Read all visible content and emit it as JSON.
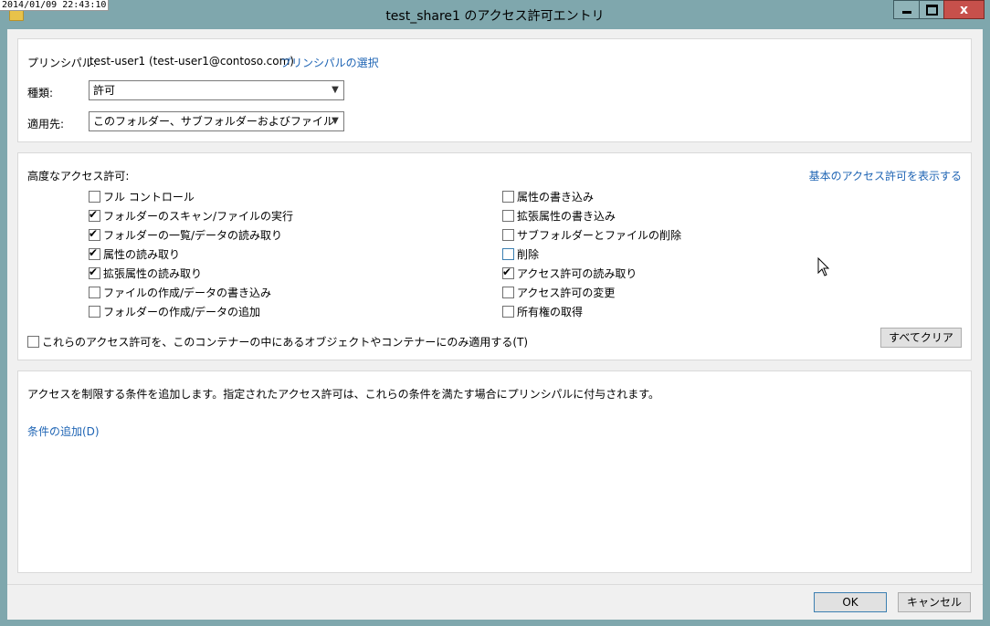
{
  "titlebar": {
    "timestamp": "2014/01/09 22:43:10",
    "title": "test_share1 のアクセス許可エントリ",
    "close_glyph": "x"
  },
  "principal": {
    "label": "プリンシパル:",
    "value": "test-user1 (test-user1@contoso.com)",
    "select_link": "プリンシパルの選択"
  },
  "type": {
    "label": "種類:",
    "value": "許可"
  },
  "applies_to": {
    "label": "適用先:",
    "value": "このフォルダー、サブフォルダーおよびファイル"
  },
  "advanced": {
    "heading": "高度なアクセス許可:",
    "basic_link": "基本のアクセス許可を表示する",
    "left": [
      {
        "label": "フル コントロール",
        "checked": false
      },
      {
        "label": "フォルダーのスキャン/ファイルの実行",
        "checked": true
      },
      {
        "label": "フォルダーの一覧/データの読み取り",
        "checked": true
      },
      {
        "label": "属性の読み取り",
        "checked": true
      },
      {
        "label": "拡張属性の読み取り",
        "checked": true
      },
      {
        "label": "ファイルの作成/データの書き込み",
        "checked": false
      },
      {
        "label": "フォルダーの作成/データの追加",
        "checked": false
      }
    ],
    "right": [
      {
        "label": "属性の書き込み",
        "checked": false
      },
      {
        "label": "拡張属性の書き込み",
        "checked": false
      },
      {
        "label": "サブフォルダーとファイルの削除",
        "checked": false
      },
      {
        "label": "削除",
        "checked": false
      },
      {
        "label": "アクセス許可の読み取り",
        "checked": true
      },
      {
        "label": "アクセス許可の変更",
        "checked": false
      },
      {
        "label": "所有権の取得",
        "checked": false
      }
    ],
    "apply_only_label": "これらのアクセス許可を、このコンテナーの中にあるオブジェクトやコンテナーにのみ適用する(T)",
    "clear_all": "すべてクリア"
  },
  "conditions": {
    "description": "アクセスを制限する条件を追加します。指定されたアクセス許可は、これらの条件を満たす場合にプリンシパルに付与されます。",
    "add_link": "条件の追加(D)"
  },
  "footer": {
    "ok": "OK",
    "cancel": "キャンセル"
  }
}
